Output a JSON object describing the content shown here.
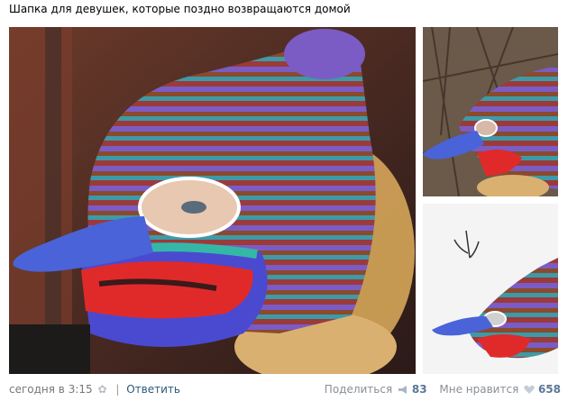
{
  "post": {
    "text": "Шапка для девушек, которые поздно возвращаются домой"
  },
  "photos": {
    "main": "knitted bird mask hat photo",
    "side1": "knitted bird mask hat photo",
    "side2": "knitted bird mask hat photo"
  },
  "footer": {
    "timestamp": "сегодня в 3:15",
    "separator": "|",
    "reply_label": "Ответить",
    "share_label": "Поделиться",
    "share_count": "83",
    "like_label": "Мне нравится",
    "like_count": "658"
  },
  "colors": {
    "link": "#2b587a",
    "count": "#5b7797",
    "muted": "#777777",
    "icon": "#b7bcc4"
  },
  "icons": {
    "settings": "gear-icon",
    "share": "megaphone-icon",
    "like": "heart-icon"
  }
}
